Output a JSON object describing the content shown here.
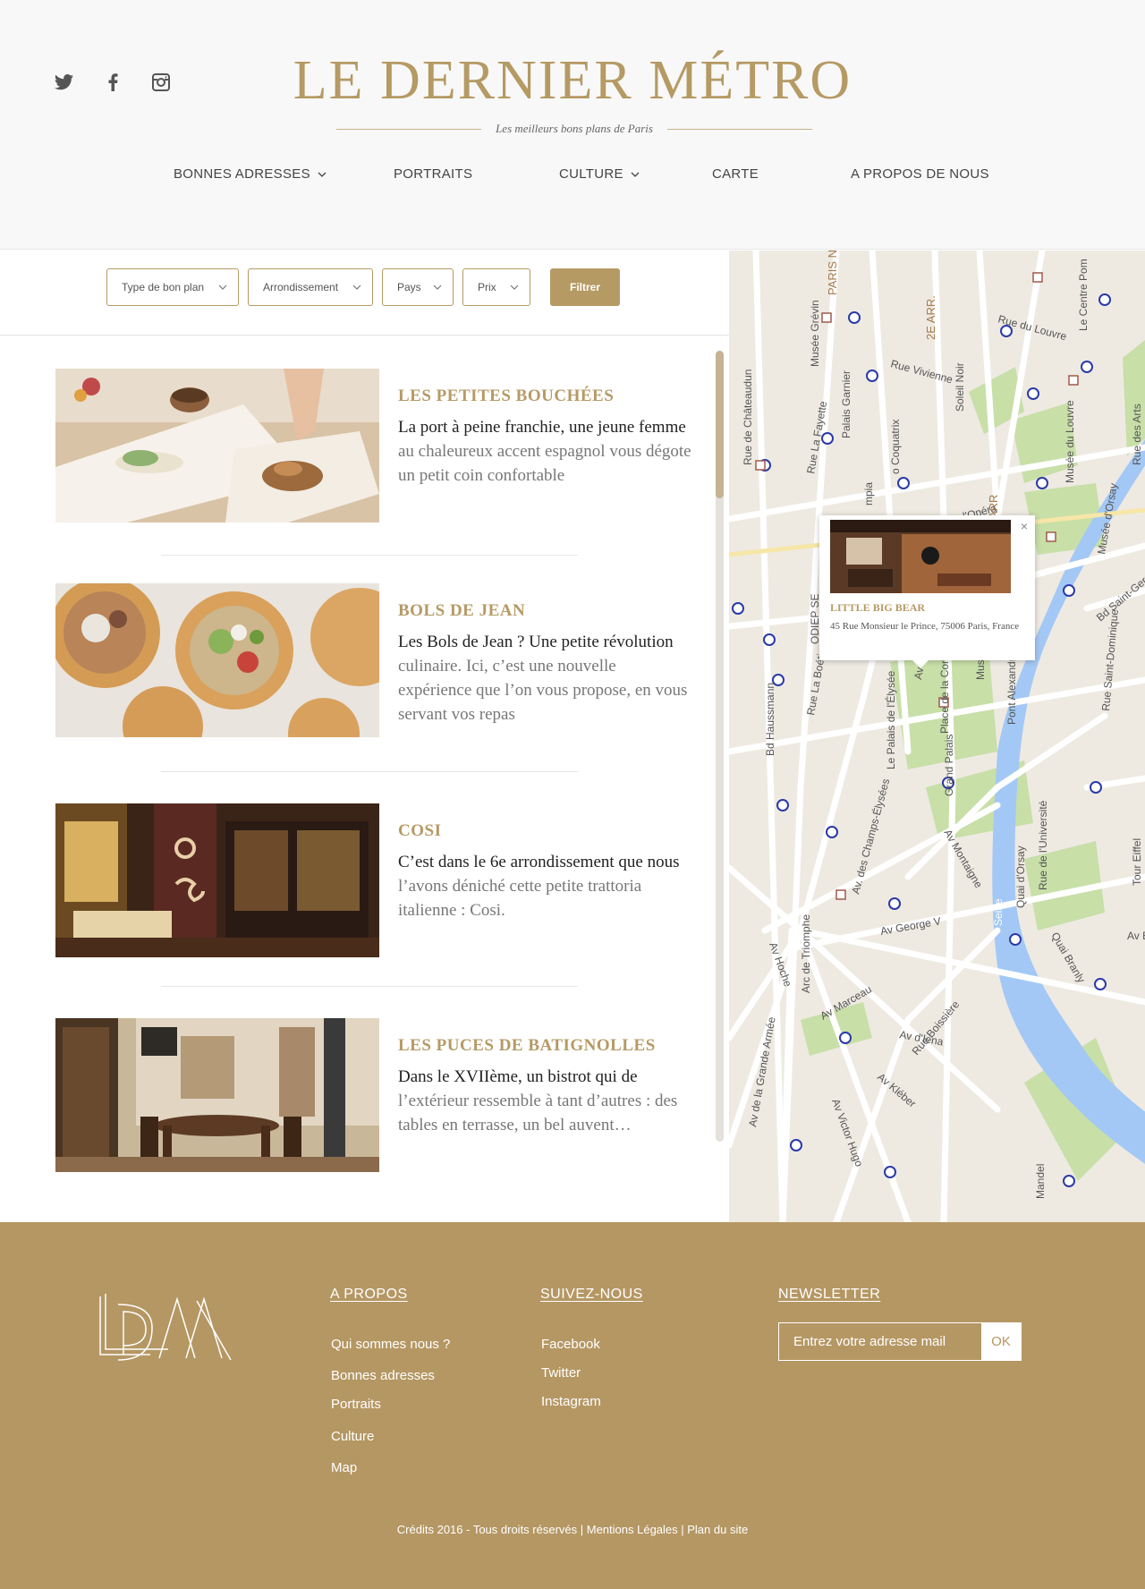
{
  "header": {
    "social_icons": [
      "twitter-icon",
      "facebook-icon",
      "instagram-icon"
    ],
    "title": "LE DERNIER MÉTRO",
    "tagline": "Les meilleurs bons plans de Paris",
    "nav": [
      {
        "label": "BONNES ADRESSES",
        "has_dropdown": true
      },
      {
        "label": "PORTRAITS",
        "has_dropdown": false
      },
      {
        "label": "CULTURE",
        "has_dropdown": true
      },
      {
        "label": "CARTE",
        "has_dropdown": false
      },
      {
        "label": "A PROPOS DE NOUS",
        "has_dropdown": false
      }
    ]
  },
  "filters": {
    "selects": [
      "Type de bon plan",
      "Arrondissement",
      "Pays",
      "Prix"
    ],
    "button": "Filtrer"
  },
  "articles": [
    {
      "title": "LES PETITES BOUCHÉES",
      "text": "La port à peine franchie, une jeune femme au chaleureux accent espagnol vous dégote un petit coin confortable"
    },
    {
      "title": "BOLS DE JEAN",
      "text": "Les Bols de Jean ? Une petite révolution culinaire. Ici, c’est une nouvelle expérience que l’on vous propose, en vous servant vos repas"
    },
    {
      "title": "COSI",
      "text": "C’est dans le 6e arrondissement que nous l’avons déniché cette petite trattoria italienne : Cosi."
    },
    {
      "title": "LES PUCES DE BATIGNOLLES",
      "text": "Dans le XVIIème, un bistrot qui de l’extérieur ressemble à tant d’autres : des tables en terrasse, un bel auvent…"
    }
  ],
  "map": {
    "labels": [
      "PARIS N",
      "2E ARR.",
      "Rue du Louvre",
      "Rue Vivienne",
      "Soleil Noir",
      "Le Centre Pom",
      "Rue de Châteaudun",
      "Musée Grévin",
      "Palais Garnier",
      "Rue La Fayette",
      "o Coquatrix",
      "mpia",
      "Av de l'Opéra",
      "Musée du Louvre",
      "Musée d'Orsay",
      "ARR",
      "Bd Saint-Gerr",
      "Rue Saint-Dominique",
      "ODIEP SE",
      "Rue La Boétie",
      "Bd Haussmann",
      "Le Palais de l'Élysée",
      "Av Gabriel",
      "Place de la Conco",
      "Musée de l'Or",
      "Pont Alexandre III",
      "Grand Palais",
      "Av Montaigne",
      "Av. des Champs-Élysées",
      "Av George V",
      "Seine",
      "Quai d'Orsay",
      "Rue de l'Université",
      "Arc de Triomphe",
      "Av Hoche",
      "Av Marceau",
      "Av d'Iena",
      "Av Kléber",
      "Av Victor Hugo",
      "Rue Boissière",
      "Av de la Grande Armée",
      "Quai Branly",
      "Tour Eiffel",
      "Av Bo",
      "Mandel",
      "Rue des Arts"
    ],
    "popup": {
      "title": "LITTLE BIG BEAR",
      "address": "45 Rue Monsieur le Prince, 75006 Paris, France",
      "close": "×"
    }
  },
  "footer": {
    "logo": "LDM",
    "about_heading": "A PROPOS",
    "about_links": [
      "Qui sommes nous ?",
      "Bonnes adresses",
      "Portraits",
      "Culture",
      "Map"
    ],
    "follow_heading": "SUIVEZ-NOUS",
    "follow_links": [
      "Facebook",
      "Twitter",
      "Instagram"
    ],
    "newsletter_heading": "NEWSLETTER",
    "newsletter_placeholder": "Entrez votre adresse mail",
    "newsletter_button": "OK",
    "credits": "Crédits 2016 - Tous droits réservés | Mentions Légales | Plan du site"
  },
  "colors": {
    "brand": "#b59a64",
    "footer_bg": "#b59763",
    "water": "#a3c8f5",
    "park": "#c8dfa8"
  }
}
